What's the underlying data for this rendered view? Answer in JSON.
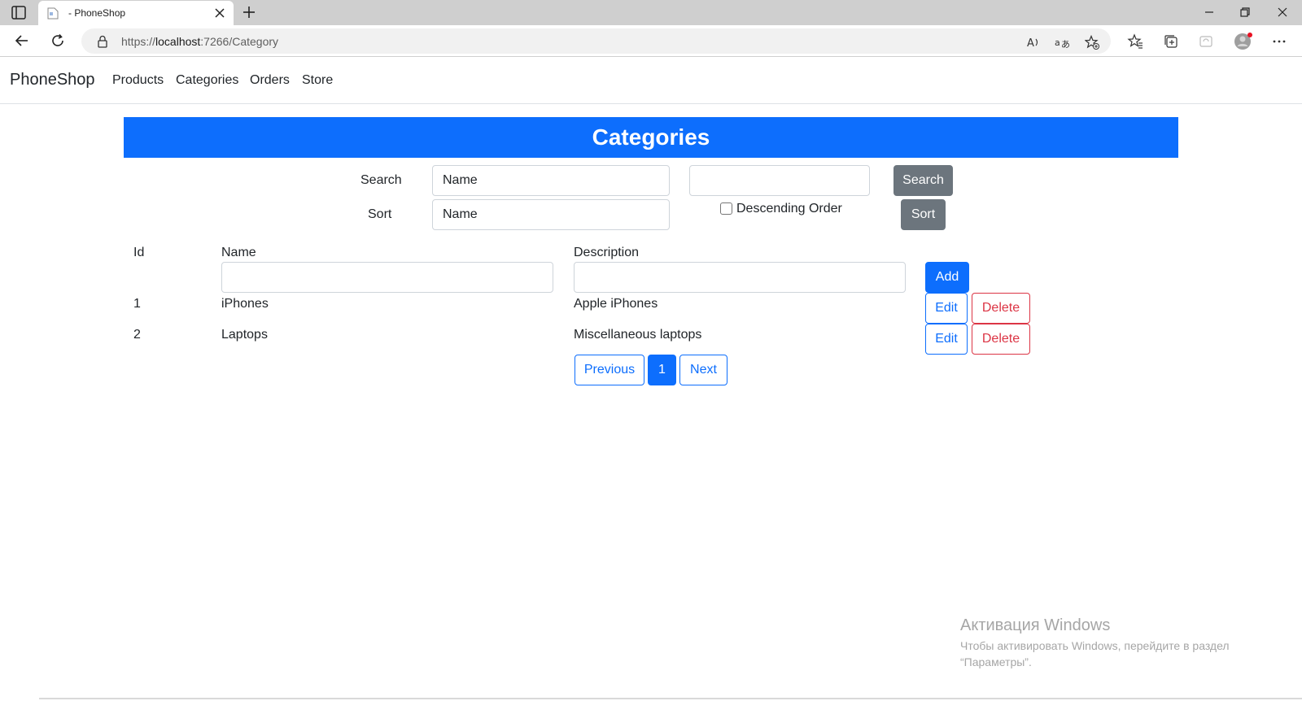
{
  "browser": {
    "tab_title": "- PhoneShop",
    "url_scheme": "https://",
    "url_host": "localhost",
    "url_rest": ":7266/Category"
  },
  "navbar": {
    "brand": "PhoneShop",
    "links": [
      "Products",
      "Categories",
      "Orders",
      "Store"
    ]
  },
  "banner": {
    "title": "Categories"
  },
  "controls": {
    "search_label": "Search",
    "search_field_value": "Name",
    "search_text_value": "",
    "search_button": "Search",
    "sort_label": "Sort",
    "sort_field_value": "Name",
    "descending_label": "Descending Order",
    "sort_button": "Sort"
  },
  "table": {
    "headers": {
      "id": "Id",
      "name": "Name",
      "description": "Description"
    },
    "new_name_value": "",
    "new_description_value": "",
    "add_button": "Add",
    "rows": [
      {
        "id": "1",
        "name": "iPhones",
        "description": "Apple iPhones",
        "edit": "Edit",
        "delete": "Delete"
      },
      {
        "id": "2",
        "name": "Laptops",
        "description": "Miscellaneous laptops",
        "edit": "Edit",
        "delete": "Delete"
      }
    ]
  },
  "pagination": {
    "previous": "Previous",
    "current": "1",
    "next": "Next"
  },
  "watermark": {
    "title": "Активация Windows",
    "line1": "Чтобы активировать Windows, перейдите в раздел",
    "line2": "“Параметры”."
  }
}
